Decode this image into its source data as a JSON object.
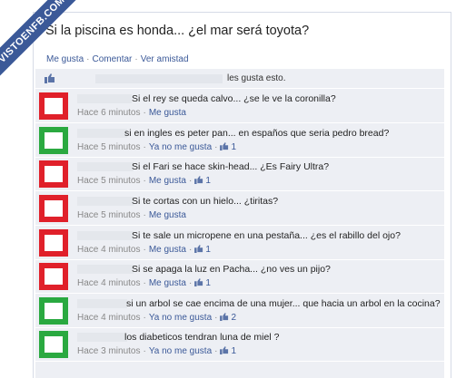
{
  "banner": "VISTOENFB.COM",
  "status": "Si la piscina es honda... ¿el mar será toyota?",
  "actions": {
    "like": "Me gusta",
    "comment": "Comentar",
    "friendship": "Ver amistad"
  },
  "likes_text": "les gusta esto.",
  "comments": [
    {
      "avatar": "red",
      "text": "Si el rey se queda calvo... ¿se le ve la coronilla?",
      "time": "Hace 6 minutos",
      "action": "Me gusta",
      "likes": ""
    },
    {
      "avatar": "green",
      "text": "si en ingles es peter pan... en españos que seria pedro bread?",
      "time": "Hace 5 minutos",
      "action": "Ya no me gusta",
      "likes": "1"
    },
    {
      "avatar": "red",
      "text": "Si el Fari se hace skin-head... ¿Es Fairy Ultra?",
      "time": "Hace 5 minutos",
      "action": "Me gusta",
      "likes": "1"
    },
    {
      "avatar": "red",
      "text": "Si te cortas con un hielo... ¿tiritas?",
      "time": "Hace 5 minutos",
      "action": "Me gusta",
      "likes": ""
    },
    {
      "avatar": "red",
      "text": "Si te sale un micropene en una pestaña... ¿es el rabillo del ojo?",
      "time": "Hace 4 minutos",
      "action": "Me gusta",
      "likes": "1"
    },
    {
      "avatar": "red",
      "text": "Si se apaga la luz en Pacha... ¿no ves un pijo?",
      "time": "Hace 4 minutos",
      "action": "Me gusta",
      "likes": "1"
    },
    {
      "avatar": "green",
      "text": "si un arbol se cae encima de una mujer... que hacia un arbol en la cocina?",
      "time": "Hace 4 minutos",
      "action": "Ya no me gusta",
      "likes": "2"
    },
    {
      "avatar": "green",
      "text": "los diabeticos tendran luna de miel ?",
      "time": "Hace 3 minutos",
      "action": "Ya no me gusta",
      "likes": "1"
    }
  ]
}
